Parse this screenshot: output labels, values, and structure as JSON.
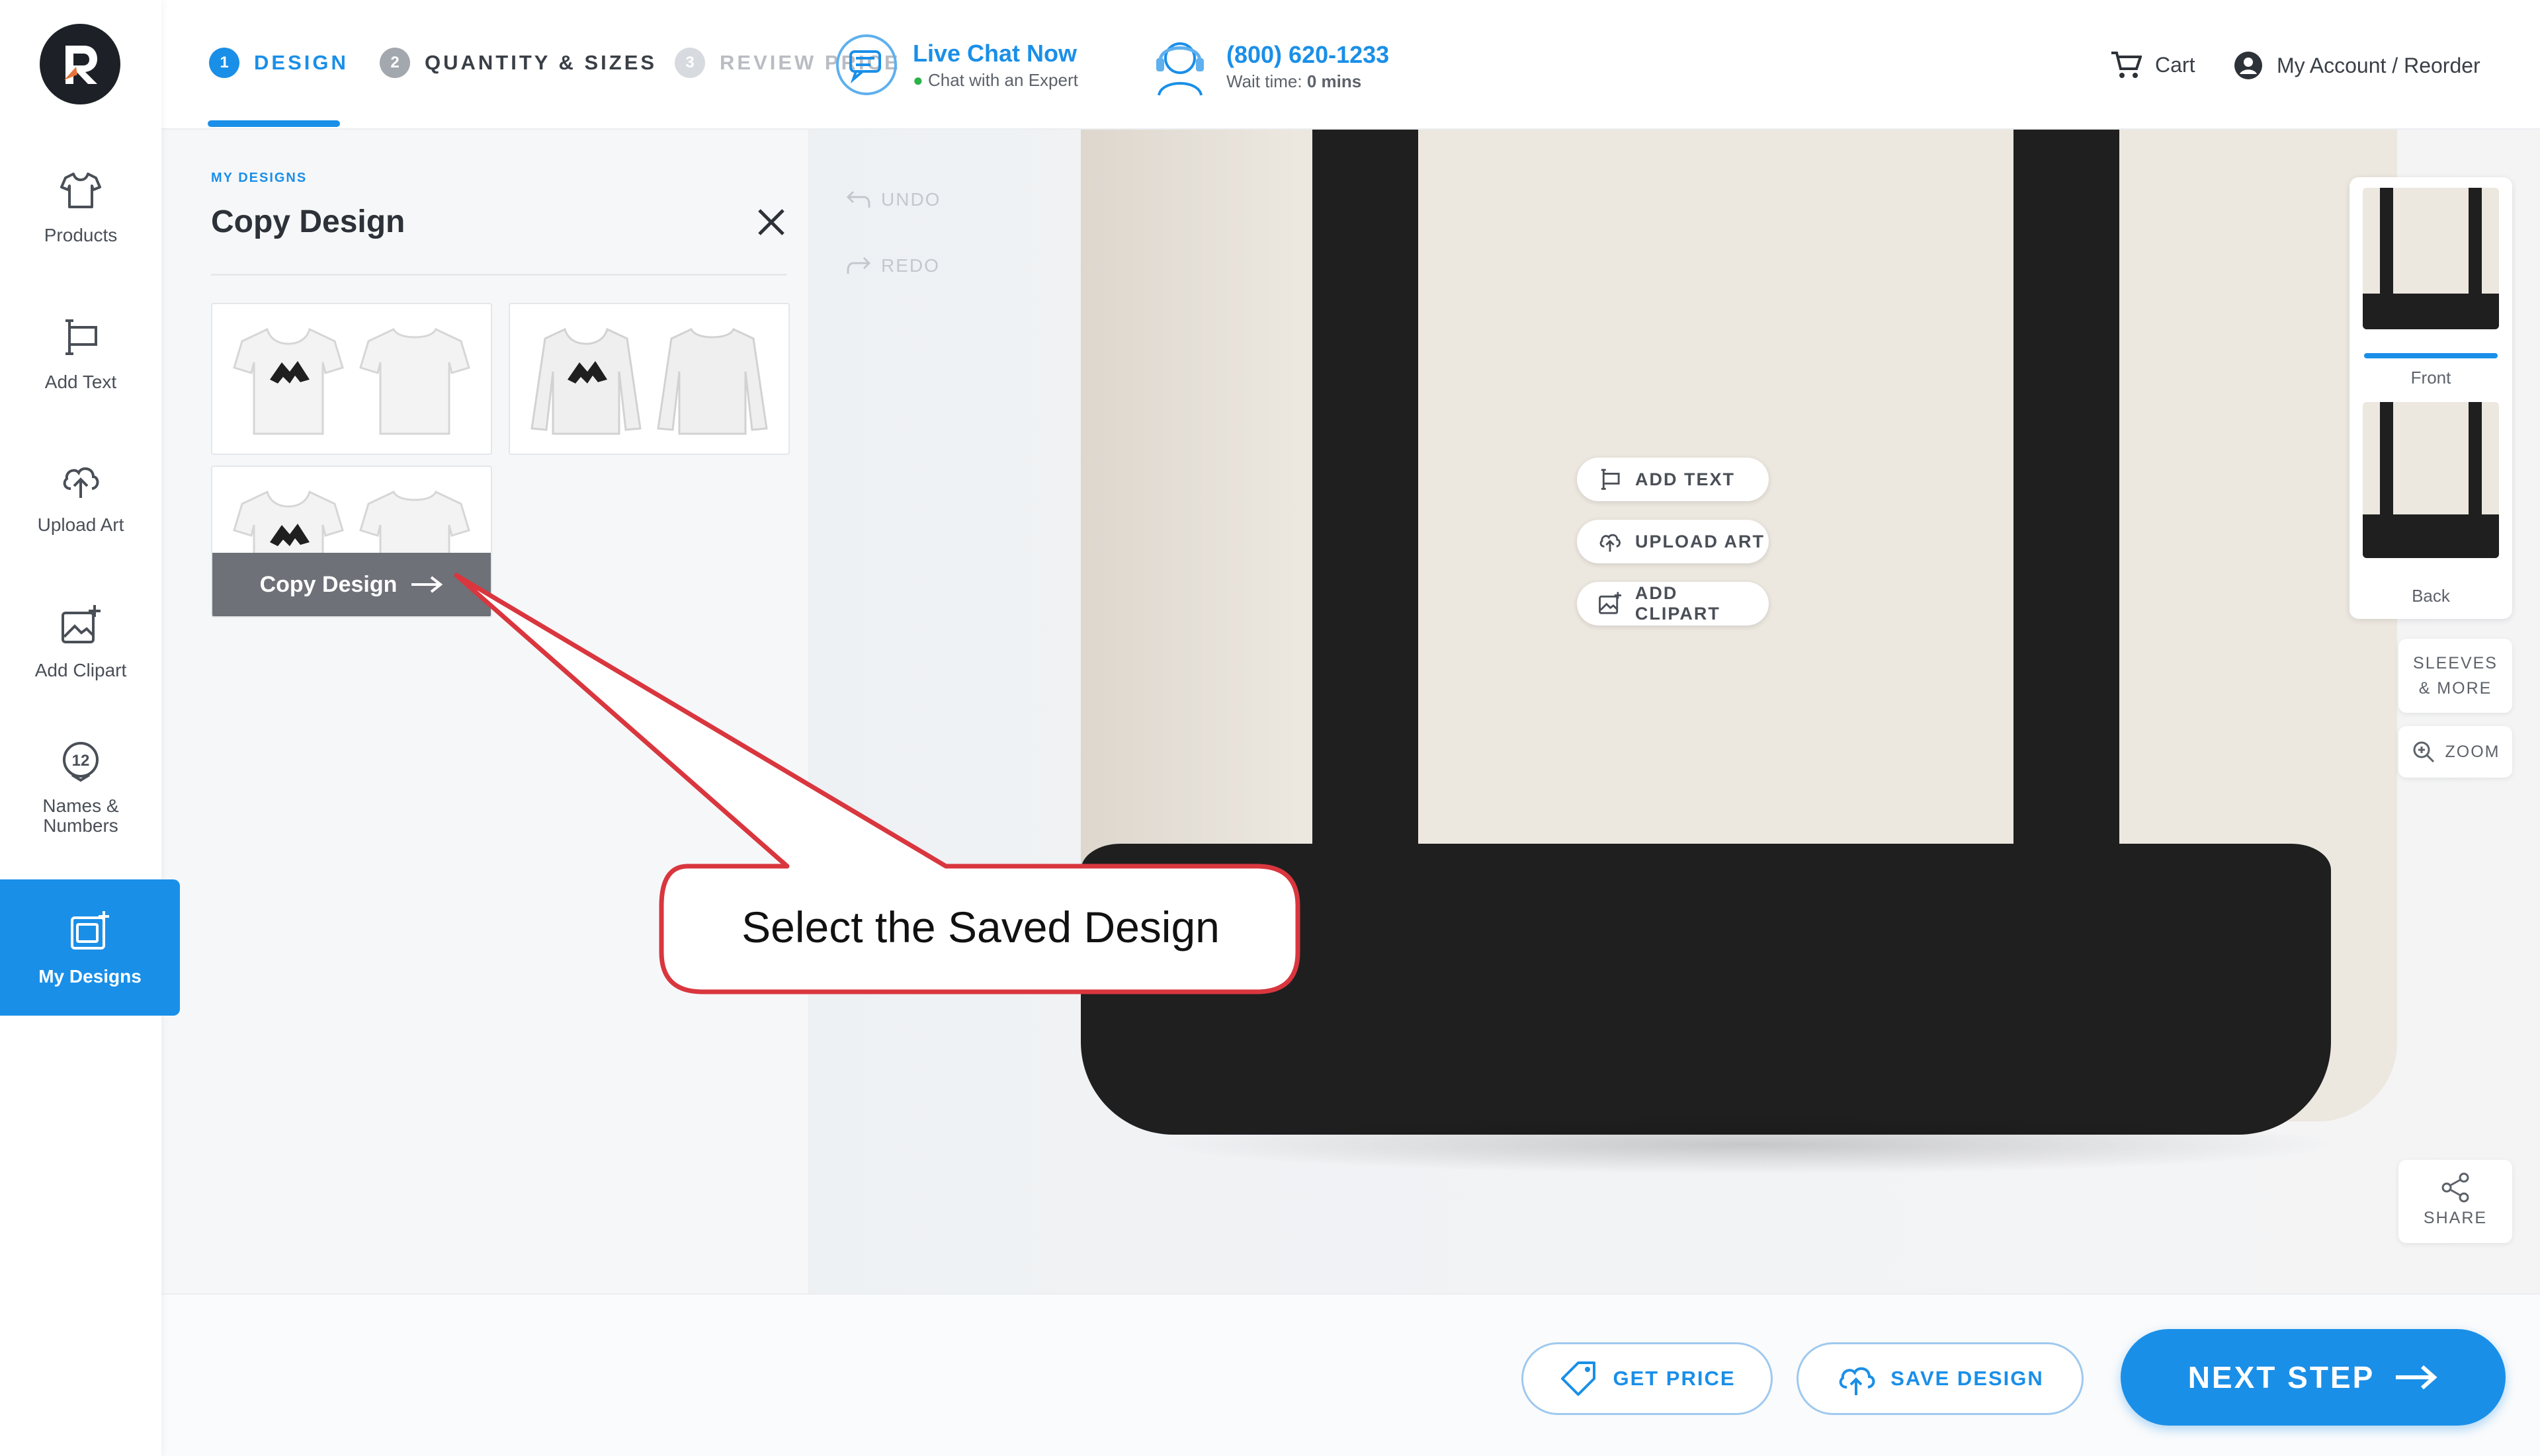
{
  "sidebar": {
    "items": [
      {
        "label": "Products",
        "icon": "tshirt-icon"
      },
      {
        "label": "Add Text",
        "icon": "text-cursor-icon"
      },
      {
        "label": "Upload Art",
        "icon": "cloud-upload-icon"
      },
      {
        "label": "Add Clipart",
        "icon": "image-plus-icon"
      },
      {
        "label": "Names & Numbers",
        "icon": "number-badge-icon"
      },
      {
        "label": "My Designs",
        "icon": "my-designs-icon"
      }
    ],
    "active_index": 5
  },
  "header": {
    "steps": [
      {
        "num": "1",
        "label": "DESIGN",
        "state": "active"
      },
      {
        "num": "2",
        "label": "QUANTITY & SIZES",
        "state": "inactive"
      },
      {
        "num": "3",
        "label": "REVIEW PRICE",
        "state": "disabled"
      }
    ],
    "live_chat": {
      "title": "Live Chat Now",
      "subtitle": "Chat with an Expert"
    },
    "phone": {
      "number": "(800) 620-1233",
      "wait_label": "Wait time:",
      "wait_value": "0 mins"
    },
    "cart_label": "Cart",
    "account_label": "My Account / Reorder"
  },
  "panel": {
    "kicker": "MY DESIGNS",
    "title": "Copy Design",
    "copy_button_label": "Copy Design",
    "designs": [
      {
        "type": "tshirt"
      },
      {
        "type": "longsleeve"
      },
      {
        "type": "tshirt"
      }
    ]
  },
  "canvas": {
    "undo_label": "UNDO",
    "redo_label": "REDO",
    "actions": [
      {
        "label": "ADD TEXT",
        "icon": "text-cursor-icon"
      },
      {
        "label": "UPLOAD ART",
        "icon": "cloud-upload-icon"
      },
      {
        "label": "ADD CLIPART",
        "icon": "image-plus-icon"
      }
    ]
  },
  "right_rail": {
    "views": [
      {
        "label": "Front"
      },
      {
        "label": "Back"
      }
    ],
    "sleeves_label": "SLEEVES & MORE",
    "zoom_label": "ZOOM",
    "share_label": "SHARE"
  },
  "footer": {
    "get_price_label": "GET PRICE",
    "save_design_label": "SAVE DESIGN",
    "next_step_label": "NEXT STEP"
  },
  "callout": {
    "text": "Select the Saved Design"
  },
  "colors": {
    "accent": "#1a8fe8",
    "bag_canvas": "#ece7df",
    "bag_trim": "#1f1f20",
    "callout_border": "#d9363e"
  }
}
